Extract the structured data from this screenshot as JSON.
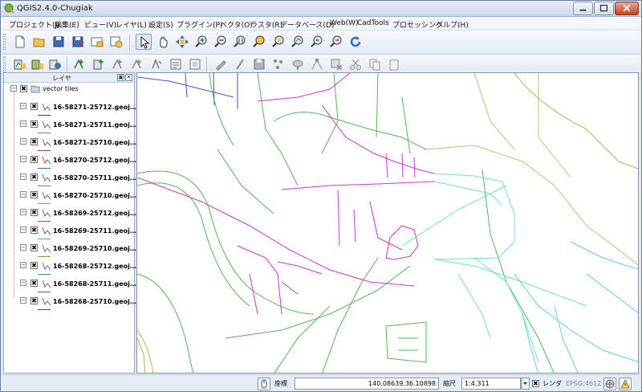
{
  "window": {
    "title": "QGIS2.4.0-Chugiak",
    "minimize_label": "minimize",
    "maximize_label": "maximize",
    "close_label": "close"
  },
  "menubar": {
    "items": [
      {
        "label": "プロジェクト(J)"
      },
      {
        "label": "編集(E)"
      },
      {
        "label": "ビュー(V)"
      },
      {
        "label": "レイヤ(L)"
      },
      {
        "label": "設定(S)"
      },
      {
        "label": "プラグイン(P)"
      },
      {
        "label": "ベクタ(O)"
      },
      {
        "label": "ラスタ(R)"
      },
      {
        "label": "データベース(D)"
      },
      {
        "label": "Web(W)"
      },
      {
        "label": "CadTools"
      },
      {
        "label": "プロセッシング"
      },
      {
        "label": "ヘルプ(H)"
      }
    ]
  },
  "toolbar1": {
    "icons": [
      "new-project-icon",
      "open-project-icon",
      "save-project-icon",
      "save-as-icon",
      "print-composer-icon",
      "composer-manager-icon",
      "select-pointer-icon",
      "pan-icon",
      "pan-to-selection-icon",
      "zoom-in-icon",
      "zoom-out-icon",
      "zoom-native-icon",
      "zoom-full-icon",
      "zoom-to-selection-icon",
      "zoom-to-layer-icon",
      "zoom-last-icon",
      "zoom-next-icon",
      "refresh-icon"
    ]
  },
  "toolbar2": {
    "icons": [
      "add-vector-layer-icon",
      "add-raster-layer-icon",
      "add-postgis-layer-icon",
      "add-spatialite-layer-icon",
      "add-mssql-layer-icon",
      "add-wms-layer-icon",
      "add-wcs-layer-icon",
      "add-wfs-layer-icon",
      "add-delimited-text-icon",
      "new-shapefile-icon",
      "toggle-editing-icon",
      "digitize-icon",
      "save-edits-icon",
      "add-feature-icon",
      "move-feature-icon",
      "node-tool-icon",
      "delete-selected-icon",
      "cut-features-icon",
      "copy-features-icon",
      "paste-features-icon"
    ]
  },
  "layers_panel": {
    "title": "レイヤ",
    "float_label": "▣",
    "close_label": "✕",
    "group": {
      "name": "vector tiles",
      "expander": "−",
      "check": "✖"
    },
    "layers": [
      {
        "name": "16-58271-25712.geoj…",
        "check": "✖",
        "expander": "−",
        "color": "#3b3b9b"
      },
      {
        "name": "16-58271-25711.geoj…",
        "check": "✖",
        "expander": "−",
        "color": "#9b7e3b"
      },
      {
        "name": "16-58271-25710.geoj…",
        "check": "✖",
        "expander": "−",
        "color": "#7e3b9b"
      },
      {
        "name": "16-58270-25712.geoj…",
        "check": "✖",
        "expander": "−",
        "color": "#3b6e9b"
      },
      {
        "name": "16-58270-25711.geoj…",
        "check": "✖",
        "expander": "−",
        "color": "#4aa84a"
      },
      {
        "name": "16-58270-25710.geoj…",
        "check": "✖",
        "expander": "−",
        "color": "#b48a3a"
      },
      {
        "name": "16-58269-25712.geoj…",
        "check": "✖",
        "expander": "−",
        "color": "#b43ab4"
      },
      {
        "name": "16-58269-25711.geoj…",
        "check": "✖",
        "expander": "−",
        "color": "#3ab4a8"
      },
      {
        "name": "16-58269-25710.geoj…",
        "check": "✖",
        "expander": "−",
        "color": "#8a9b3b"
      },
      {
        "name": "16-58268-25712.geoj…",
        "check": "✖",
        "expander": "−",
        "color": "#3a8ab4"
      },
      {
        "name": "16-58268-25711.geoj…",
        "check": "✖",
        "expander": "−",
        "color": "#a43a6e"
      },
      {
        "name": "16-58268-25710.geoj…",
        "check": "✖",
        "expander": "−",
        "color": "#3a3ab4"
      }
    ]
  },
  "map": {
    "colors": {
      "magenta": "#cc33cc",
      "green": "#4dbb4d",
      "teal": "#6ee0c8",
      "cyan": "#66c8e6",
      "olive": "#b8b04a",
      "lightgreen": "#9bd66b",
      "blue": "#4d4dcc",
      "tan": "#c8a060"
    }
  },
  "statusbar": {
    "coord_label": "座標",
    "coord_value": "140.08639,36.10898",
    "scale_label": "縮尺",
    "scale_value": "1:4,311",
    "render_check": "✖",
    "render_label": "レンダ",
    "epsg": "EPSG:4612"
  }
}
